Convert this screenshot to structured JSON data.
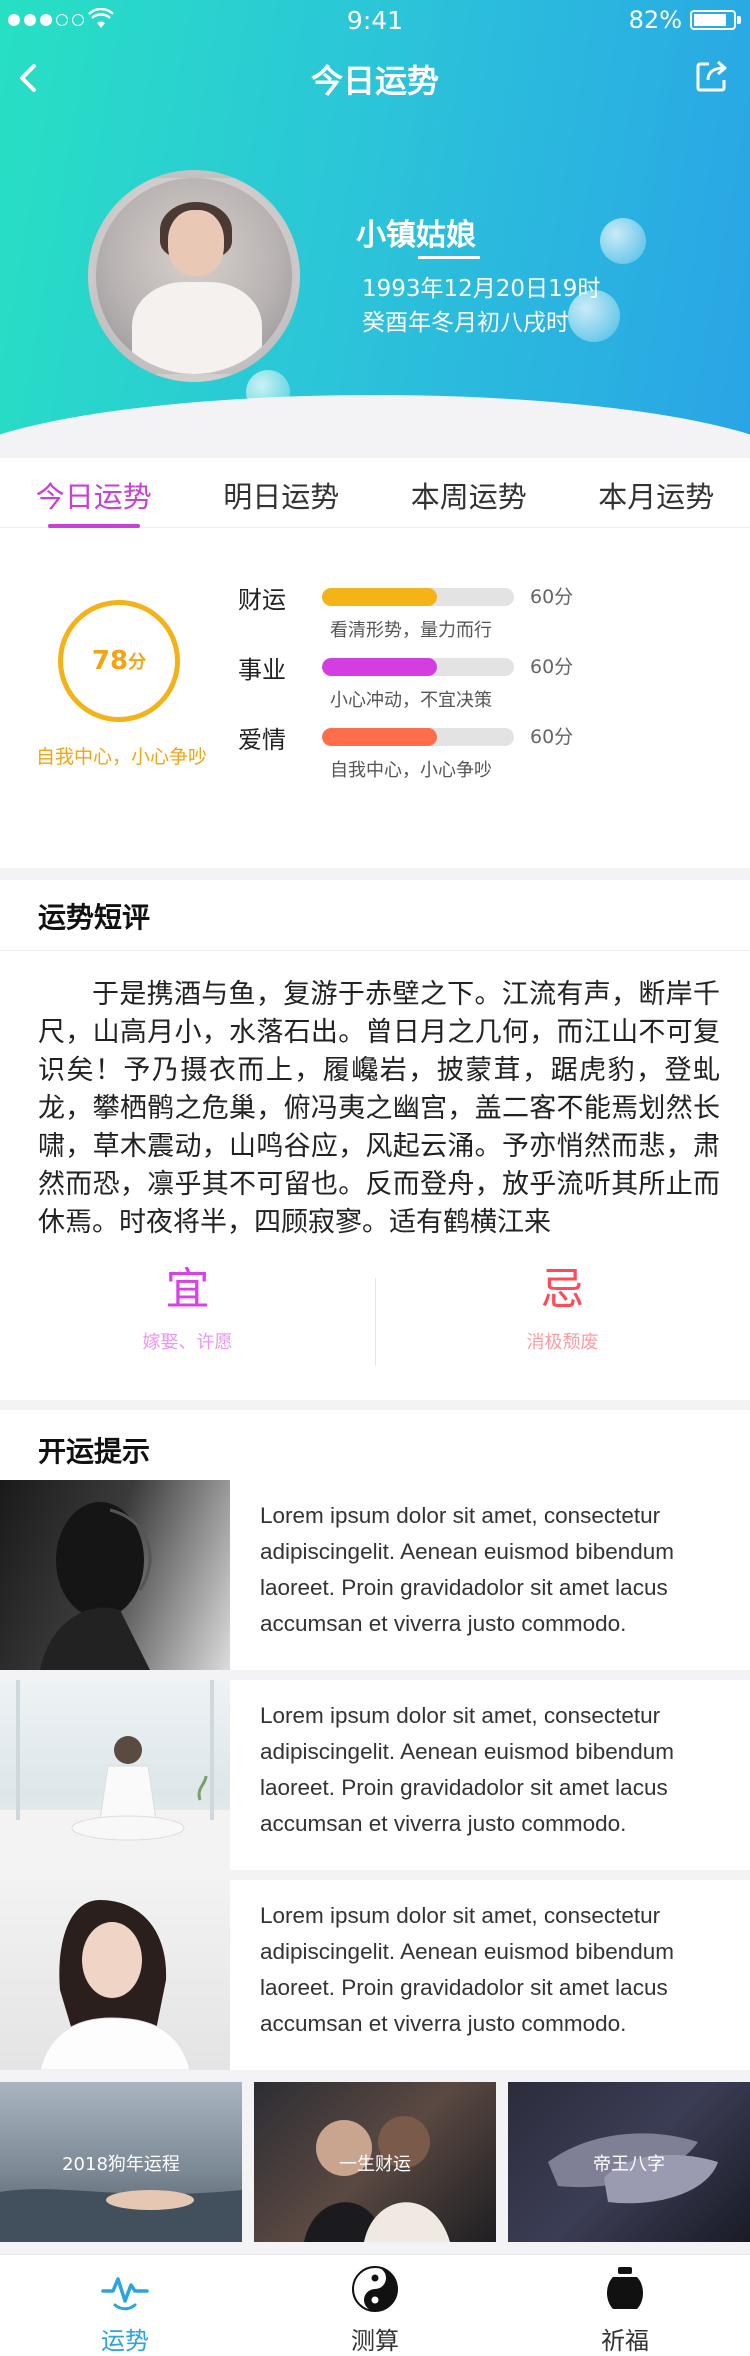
{
  "status_bar": {
    "time": "9:41",
    "battery": "82%"
  },
  "nav": {
    "title": "今日运势"
  },
  "profile": {
    "name": "小镇姑娘",
    "birth_date": "1993年12月20日19时",
    "lunar_date": "癸酉年冬月初八戌时"
  },
  "tabs": [
    {
      "label": "今日运势",
      "active": true
    },
    {
      "label": "明日运势",
      "active": false
    },
    {
      "label": "本周运势",
      "active": false
    },
    {
      "label": "本月运势",
      "active": false
    }
  ],
  "overall": {
    "score": "78",
    "unit": "分",
    "note": "自我中心，小心争吵"
  },
  "metrics": [
    {
      "label": "财运",
      "score": "60分",
      "percent": 0.6,
      "note": "看清形势，量力而行",
      "color": "#f4b418"
    },
    {
      "label": "事业",
      "score": "60分",
      "percent": 0.6,
      "note": "小心冲动，不宜决策",
      "color": "#d43ee0"
    },
    {
      "label": "爱情",
      "score": "60分",
      "percent": 0.6,
      "note": "自我中心，小心争吵",
      "color": "#ff6e4a"
    }
  ],
  "review": {
    "title": "运势短评",
    "text": "于是携酒与鱼，复游于赤壁之下。江流有声，断岸千尺，山高月小，水落石出。曾日月之几何，而江山不可复识矣！予乃摄衣而上，履巉岩，披蒙茸，踞虎豹，登虬龙，攀栖鹘之危巢，俯冯夷之幽宫，盖二客不能焉划然长啸，草木震动，山鸣谷应，风起云涌。予亦悄然而悲，肃然而恐，凛乎其不可留也。反而登舟，放乎流听其所止而休焉。时夜将半，四顾寂寥。适有鹤横江来"
  },
  "yi": {
    "char": "宜",
    "note": "嫁娶、许愿",
    "color": "#d840e8"
  },
  "ji": {
    "char": "忌",
    "note": "消极颓废",
    "color": "#ff4a5a"
  },
  "tips": {
    "title": "开运提示",
    "items": [
      {
        "text": "Lorem ipsum dolor sit amet, consectetur adipiscingelit. Aenean euismod bibendum laoreet. Proin gravidadolor sit amet lacus accumsan et viverra justo commodo."
      },
      {
        "text": "Lorem ipsum dolor sit amet, consectetur adipiscingelit. Aenean euismod bibendum laoreet. Proin gravidadolor sit amet lacus accumsan et viverra justo commodo."
      },
      {
        "text": "Lorem ipsum dolor sit amet, consectetur adipiscingelit. Aenean euismod bibendum laoreet. Proin gravidadolor sit amet lacus accumsan et viverra justo commodo."
      }
    ]
  },
  "thumbs": [
    {
      "label": "2018狗年运程"
    },
    {
      "label": "一生财运"
    },
    {
      "label": "帝王八字"
    }
  ],
  "tabbar": [
    {
      "label": "运势",
      "icon": "pulse-icon",
      "active": true
    },
    {
      "label": "测算",
      "icon": "yin-yang-icon",
      "active": false
    },
    {
      "label": "祈福",
      "icon": "pot-icon",
      "active": false
    }
  ]
}
